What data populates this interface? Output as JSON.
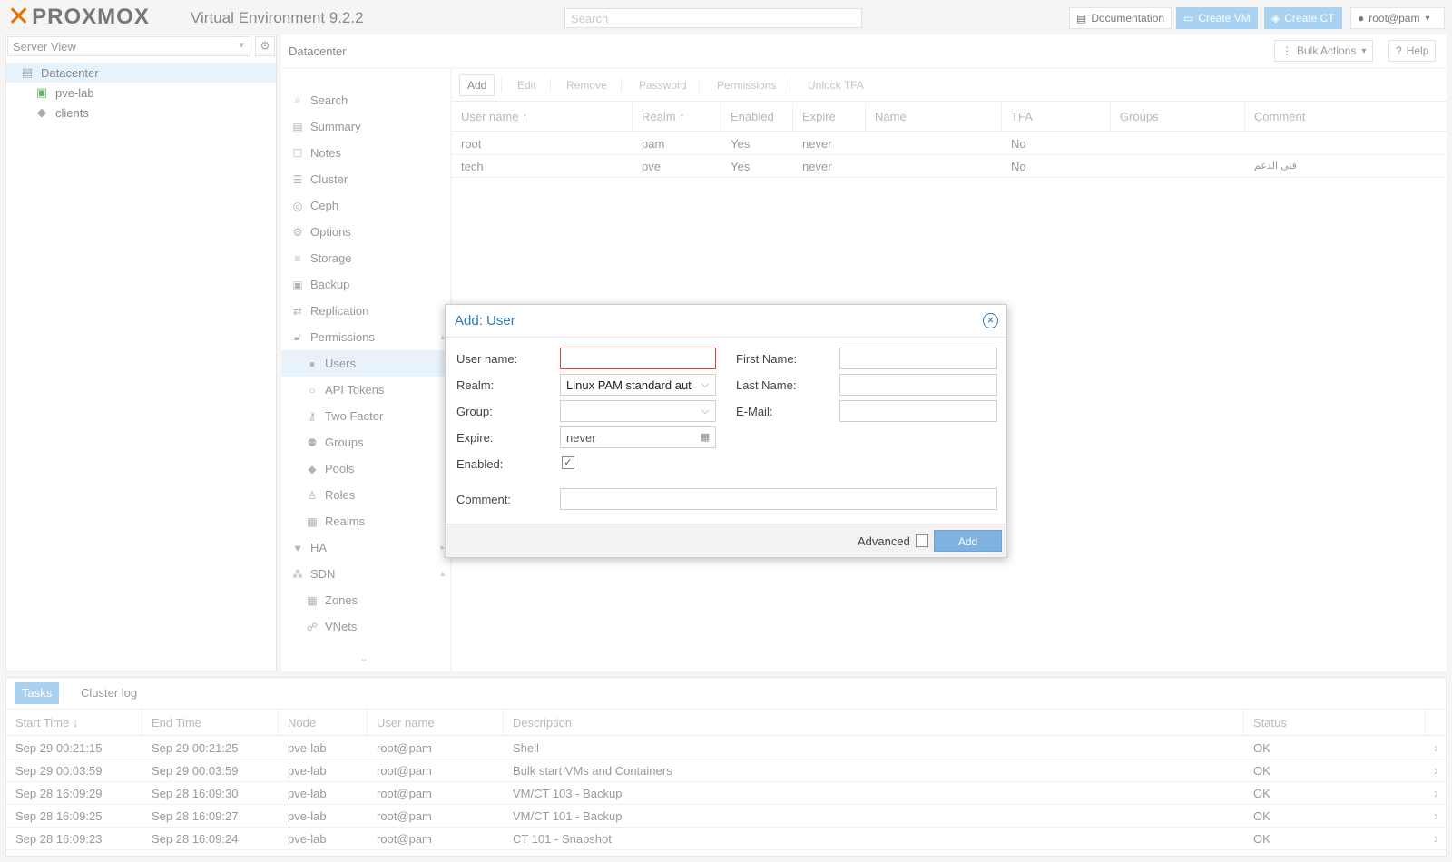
{
  "header": {
    "brand": "PROXMOX",
    "version": "Virtual Environment 9.2.2",
    "search_placeholder": "Search",
    "documentation_label": "Documentation",
    "create_vm_label": "Create VM",
    "create_ct_label": "Create CT",
    "user_label": "root@pam"
  },
  "tree": {
    "view_label": "Server View",
    "nodes": [
      {
        "label": "Datacenter",
        "icon": "server-icon"
      },
      {
        "label": "pve-lab",
        "icon": "node-icon"
      },
      {
        "label": "clients",
        "icon": "tags-icon"
      }
    ]
  },
  "content_header": {
    "title": "Datacenter",
    "bulk_actions_label": "Bulk Actions",
    "help_label": "Help"
  },
  "nav": {
    "items": [
      {
        "label": "Search"
      },
      {
        "label": "Summary"
      },
      {
        "label": "Notes"
      },
      {
        "label": "Cluster"
      },
      {
        "label": "Ceph"
      },
      {
        "label": "Options"
      },
      {
        "label": "Storage"
      },
      {
        "label": "Backup"
      },
      {
        "label": "Replication"
      },
      {
        "label": "Permissions"
      },
      {
        "label": "Users"
      },
      {
        "label": "API Tokens"
      },
      {
        "label": "Two Factor"
      },
      {
        "label": "Groups"
      },
      {
        "label": "Pools"
      },
      {
        "label": "Roles"
      },
      {
        "label": "Realms"
      },
      {
        "label": "HA"
      },
      {
        "label": "SDN"
      },
      {
        "label": "Zones"
      },
      {
        "label": "VNets"
      }
    ]
  },
  "users_toolbar": {
    "add": "Add",
    "edit": "Edit",
    "remove": "Remove",
    "password": "Password",
    "permissions": "Permissions",
    "unlock_tfa": "Unlock TFA"
  },
  "users_grid": {
    "columns": [
      "User name",
      "Realm",
      "Enabled",
      "Expire",
      "Name",
      "TFA",
      "Groups",
      "Comment"
    ],
    "sort_indicator": "↑",
    "rows": [
      {
        "username": "root",
        "realm": "pam",
        "enabled": "Yes",
        "expire": "never",
        "name": "",
        "tfa": "No",
        "groups": "",
        "comment": ""
      },
      {
        "username": "tech",
        "realm": "pve",
        "enabled": "Yes",
        "expire": "never",
        "name": "",
        "tfa": "No",
        "groups": "",
        "comment": "فني الدعم"
      }
    ]
  },
  "dialog": {
    "title": "Add: User",
    "username_label": "User name:",
    "username_value": "",
    "realm_label": "Realm:",
    "realm_value": "Linux PAM standard aut",
    "group_label": "Group:",
    "group_value": "",
    "expire_label": "Expire:",
    "expire_value": "never",
    "enabled_label": "Enabled:",
    "enabled_checked": true,
    "first_name_label": "First Name:",
    "last_name_label": "Last Name:",
    "email_label": "E-Mail:",
    "comment_label": "Comment:",
    "advanced_label": "Advanced",
    "add_label": "Add"
  },
  "tasks": {
    "tabs": [
      "Tasks",
      "Cluster log"
    ],
    "columns": [
      "Start Time",
      "End Time",
      "Node",
      "User name",
      "Description",
      "Status"
    ],
    "sort_indicator": "↓",
    "rows": [
      {
        "start": "Sep 29 00:21:15",
        "end": "Sep 29 00:21:25",
        "node": "pve-lab",
        "user": "root@pam",
        "desc": "Shell",
        "status": "OK"
      },
      {
        "start": "Sep 29 00:03:59",
        "end": "Sep 29 00:03:59",
        "node": "pve-lab",
        "user": "root@pam",
        "desc": "Bulk start VMs and Containers",
        "status": "OK"
      },
      {
        "start": "Sep 28 16:09:29",
        "end": "Sep 28 16:09:30",
        "node": "pve-lab",
        "user": "root@pam",
        "desc": "VM/CT 103 - Backup",
        "status": "OK"
      },
      {
        "start": "Sep 28 16:09:25",
        "end": "Sep 28 16:09:27",
        "node": "pve-lab",
        "user": "root@pam",
        "desc": "VM/CT 101 - Backup",
        "status": "OK"
      },
      {
        "start": "Sep 28 16:09:23",
        "end": "Sep 28 16:09:24",
        "node": "pve-lab",
        "user": "root@pam",
        "desc": "CT 101 - Snapshot",
        "status": "OK"
      }
    ]
  },
  "colors": {
    "accent": "#2f79b6",
    "logo_orange": "#e57000",
    "selection": "#e8f2fb",
    "button_blue": "#a9d1f2",
    "invalid_border": "#cf4c35"
  }
}
